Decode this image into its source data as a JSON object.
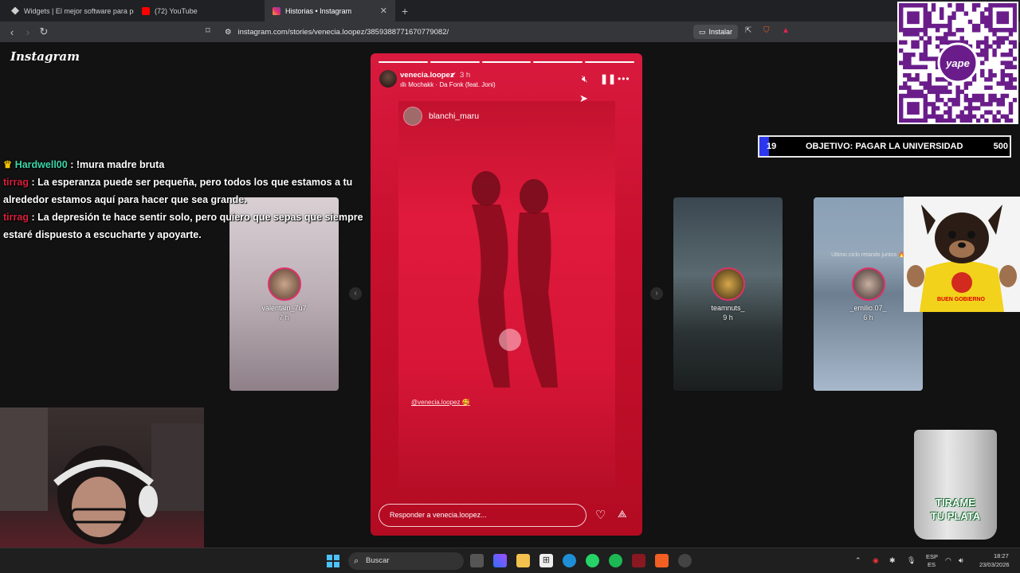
{
  "browser": {
    "tabs": [
      {
        "label": "Widgets | El mejor software para pot",
        "icon": "widgets-icon",
        "color": "#cfcfcf",
        "active": false
      },
      {
        "label": "(72) YouTube",
        "icon": "youtube-icon",
        "color": "#ff0000",
        "active": false
      },
      {
        "label": "Historias • Instagram",
        "icon": "instagram-icon",
        "color": "#e1306c",
        "active": true
      }
    ],
    "url": "instagram.com/stories/venecia.loopez/3859388771670779082/",
    "install_label": "Instalar"
  },
  "instagram": {
    "logo": "Instagram",
    "story": {
      "username": "venecia.loopez",
      "time": "3 h",
      "music": "Mochakk · Da Fonk (feat. Joni)",
      "progress_segments": 5,
      "progress_done": 5,
      "inner_username": "blanchi_maru",
      "mention": "@venecia.loopez 🥰",
      "reply_placeholder": "Responder a venecia.loopez..."
    },
    "side_stories": [
      {
        "username": "valentain_7u7",
        "time": "7 h",
        "caption": ""
      },
      {
        "username": "teamnuts_",
        "time": "9 h",
        "caption": ""
      },
      {
        "username": "_emilio.07_",
        "time": "6 h",
        "caption": "Último ciclo retando juntos 🔥"
      }
    ]
  },
  "chat": [
    {
      "user": "Hardwell00",
      "text": ": !mura madre bruta",
      "color": "#3cd6a8",
      "badge": "crown"
    },
    {
      "user": "tirrag",
      "text": ": La esperanza puede ser pequeña, pero todos los que estamos a tu alrededor estamos aquí para hacer que sea grande.",
      "color": "#d91e3b",
      "badge": ""
    },
    {
      "user": "tirrag",
      "text": ": La depresión te hace sentir solo, pero quiero que sepas que siempre estaré dispuesto a escucharte y apoyarte.",
      "color": "#d91e3b",
      "badge": ""
    }
  ],
  "goal": {
    "current": "19",
    "label": "OBJETIVO: PAGAR LA UNIVERSIDAD",
    "max": "500",
    "progress": 0.038
  },
  "qr": {
    "brand": "yape"
  },
  "dog": {
    "caption": "BUEN GOBIERNO"
  },
  "jar": {
    "line1": "TIRAME",
    "line2": "TU PLATA"
  },
  "taskbar": {
    "search_label": "Buscar",
    "lang": "ESP",
    "lang_sub": "ES",
    "time": "18:27",
    "date": "23/03/2026"
  }
}
